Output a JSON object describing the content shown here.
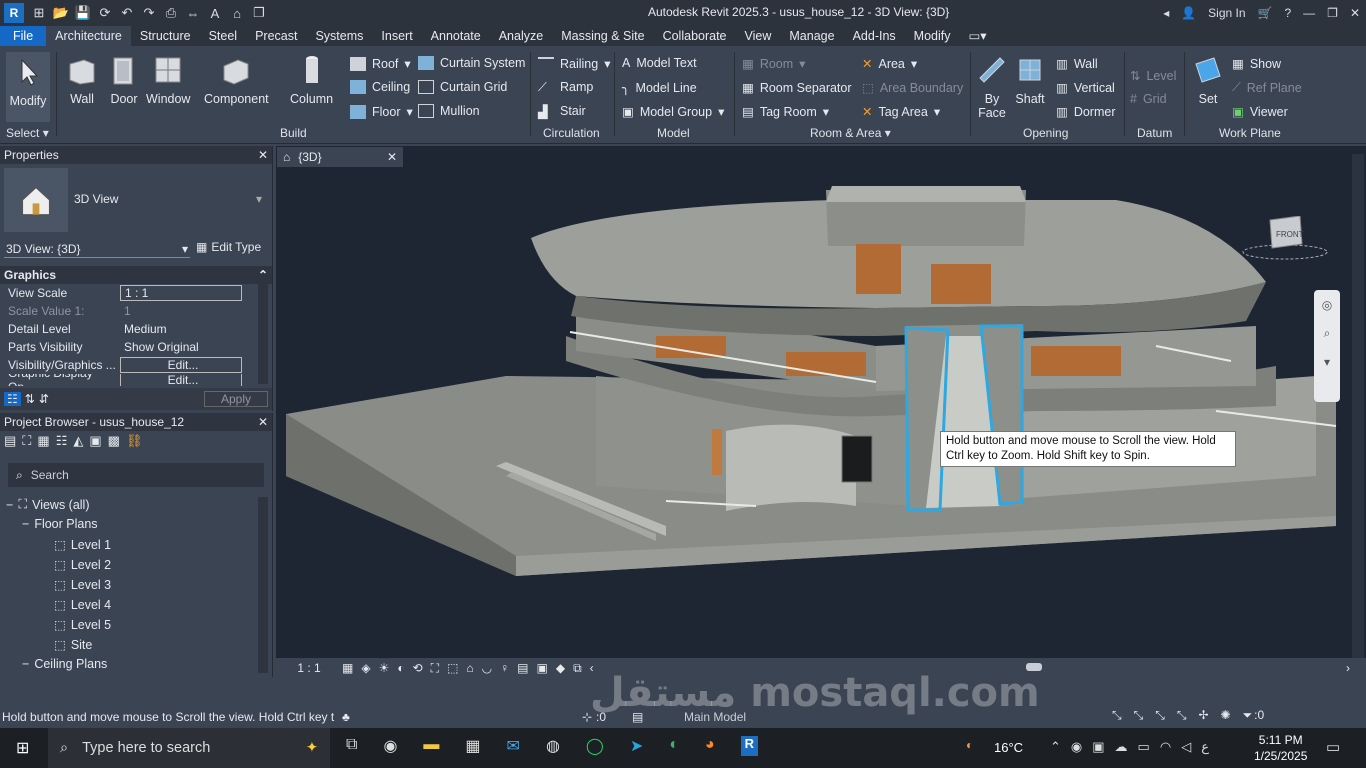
{
  "titlebar": {
    "app_icon": "R",
    "title": "Autodesk Revit 2025.3 - usus_house_12 - 3D View: {3D}",
    "sign_in": "Sign In"
  },
  "menu": [
    "File",
    "Architecture",
    "Structure",
    "Steel",
    "Precast",
    "Systems",
    "Insert",
    "Annotate",
    "Analyze",
    "Massing & Site",
    "Collaborate",
    "View",
    "Manage",
    "Add-Ins",
    "Modify"
  ],
  "ribbon": {
    "select": {
      "modify": "Modify",
      "label": "Select"
    },
    "build": {
      "label": "Build",
      "wall": "Wall",
      "door": "Door",
      "window": "Window",
      "component": "Component",
      "column": "Column",
      "roof": "Roof",
      "ceiling": "Ceiling",
      "floor": "Floor",
      "curtain_system": "Curtain System",
      "curtain_grid": "Curtain Grid",
      "mullion": "Mullion"
    },
    "circulation": {
      "label": "Circulation",
      "railing": "Railing",
      "ramp": "Ramp",
      "stair": "Stair"
    },
    "model": {
      "label": "Model",
      "model_text": "Model Text",
      "model_line": "Model Line",
      "model_group": "Model Group"
    },
    "room_area": {
      "label": "Room & Area",
      "room": "Room",
      "room_separator": "Room Separator",
      "tag_room": "Tag Room",
      "area": "Area",
      "area_boundary": "Area Boundary",
      "tag_area": "Tag Area"
    },
    "opening": {
      "label": "Opening",
      "by_face": "By",
      "by_face2": "Face",
      "shaft": "Shaft",
      "wall": "Wall",
      "vertical": "Vertical",
      "dormer": "Dormer"
    },
    "datum": {
      "label": "Datum",
      "level": "Level",
      "grid": "Grid"
    },
    "workplane": {
      "label": "Work Plane",
      "set": "Set",
      "show": "Show",
      "ref_plane": "Ref  Plane",
      "viewer": "Viewer"
    }
  },
  "properties": {
    "title": "Properties",
    "type": "3D View",
    "selector": "3D View: {3D}",
    "edit_type": "Edit Type",
    "group": "Graphics",
    "rows": [
      {
        "k": "View Scale",
        "v": "1 : 1"
      },
      {
        "k": "Scale Value    1:",
        "v": "1"
      },
      {
        "k": "Detail Level",
        "v": "Medium"
      },
      {
        "k": "Parts Visibility",
        "v": "Show Original"
      },
      {
        "k": "Visibility/Graphics ...",
        "v": "Edit..."
      },
      {
        "k": "Graphic Display Op...",
        "v": "Edit..."
      }
    ],
    "apply": "Apply"
  },
  "browser": {
    "title": "Project Browser - usus_house_12",
    "search": "Search",
    "items": [
      {
        "t": "Views (all)"
      },
      {
        "t": "Floor Plans"
      },
      {
        "t": "Level 1"
      },
      {
        "t": "Level 2"
      },
      {
        "t": "Level 3"
      },
      {
        "t": "Level 4"
      },
      {
        "t": "Level 5"
      },
      {
        "t": "Site"
      },
      {
        "t": "Ceiling Plans"
      }
    ]
  },
  "view": {
    "tab": "{3D}",
    "tooltip": "Hold button and move mouse to Scroll the view. Hold Ctrl key to Zoom. Hold Shift key to Spin.",
    "scale": "1 : 1",
    "cube_label": "FRONT"
  },
  "status": {
    "message": "Hold button and move mouse to Scroll the view. Hold Ctrl key t",
    "zero": ":0",
    "main_model": "Main Model",
    "filter_zero": ":0"
  },
  "taskbar": {
    "search": "Type here to search",
    "temp": "16°C",
    "time": "5:11 PM",
    "date": "1/25/2025",
    "lang": "ع"
  },
  "watermark": "مستقل mostaql.com"
}
